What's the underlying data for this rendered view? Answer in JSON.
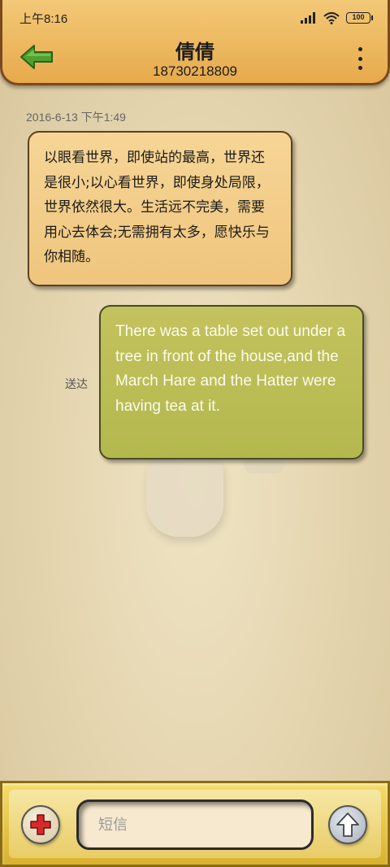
{
  "status_bar": {
    "time": "上午8:16",
    "battery": "100"
  },
  "header": {
    "contact_name": "倩倩",
    "phone_number": "18730218809"
  },
  "conversation": {
    "timestamp": "2016-6-13 下午1:49",
    "messages": [
      {
        "direction": "incoming",
        "text": "以眼看世界，即使站的最高，世界还是很小;以心看世界，即使身处局限，世界依然很大。生活远不完美，需要用心去体会;无需拥有太多，愿快乐与你相随。"
      },
      {
        "direction": "outgoing",
        "text": "There was a table set out under a tree in front of the house,and the March Hare and the Hatter were having tea at it.",
        "status": "送达"
      }
    ]
  },
  "composer": {
    "placeholder": "短信"
  },
  "icons": {
    "back": "back-arrow-icon",
    "more": "more-vertical-icon",
    "add": "plus-icon",
    "send": "up-arrow-icon"
  },
  "colors": {
    "header": "#eab660",
    "incoming_bubble": "#f2cb85",
    "outgoing_bubble": "#bcbd56",
    "bottom_bar": "#e7c64a"
  }
}
